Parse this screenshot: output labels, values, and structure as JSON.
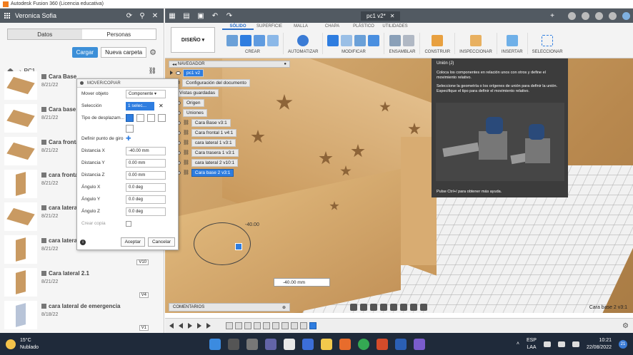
{
  "window": {
    "title": "Autodesk Fusion 360 (Licencia educativa)"
  },
  "datapanel": {
    "user": "Veronica Sofia",
    "tabs": [
      {
        "label": "Datos"
      },
      {
        "label": "Personas"
      }
    ],
    "cargar": "Cargar",
    "nueva_carpeta": "Nueva carpeta",
    "breadcrumb": "PC1",
    "files": [
      {
        "name": "Cara Base",
        "date": "8/21/22"
      },
      {
        "name": "Cara base 2",
        "date": "8/21/22"
      },
      {
        "name": "Cara frontal",
        "date": "8/21/22"
      },
      {
        "name": "cara frontal",
        "date": "8/21/22"
      },
      {
        "name": "cara lateral",
        "date": "8/21/22"
      },
      {
        "name": "cara lateral",
        "date": "8/21/22",
        "version": "V10"
      },
      {
        "name": "Cara lateral 2.1",
        "date": "8/21/22",
        "version": "V4"
      },
      {
        "name": "cara lateral de emergencia",
        "date": "8/18/22",
        "version": "V1"
      }
    ]
  },
  "toolbar": {
    "document_tab": "pc1 v2*",
    "workspace": "DISEÑO",
    "tabs": [
      "SÓLIDO",
      "SUPERFICIE",
      "MALLA",
      "CHAPA",
      "PLÁSTICO",
      "UTILIDADES"
    ],
    "groups": [
      "CREAR",
      "AUTOMATIZAR",
      "MODIFICAR",
      "ENSAMBLAR",
      "CONSTRUIR",
      "INSPECCIONAR",
      "INSERTAR",
      "SELECCIONAR"
    ]
  },
  "browser": {
    "title": "NAVEGADOR",
    "root": "pc1 v2",
    "items": [
      {
        "label": "Configuración del documento",
        "selected": false
      },
      {
        "label": "Vistas guardadas",
        "selected": false
      },
      {
        "label": "Origen",
        "selected": false
      },
      {
        "label": "Uniones",
        "selected": false
      },
      {
        "label": "Cara Base v3:1",
        "selected": false
      },
      {
        "label": "Cara frontal 1 v4:1",
        "selected": false
      },
      {
        "label": "cara lateral 1 v3:1",
        "selected": false
      },
      {
        "label": "Cara trasera 1 v3:1",
        "selected": false
      },
      {
        "label": "cara lateral 2 v10:1",
        "selected": false
      },
      {
        "label": "Cara base 2 v3:1",
        "selected": true
      }
    ]
  },
  "dialog": {
    "title": "MOVER/COPIAR",
    "rows": [
      {
        "label": "Mover objeto",
        "value": "Componente"
      },
      {
        "label": "Selección",
        "value": "1 selec..."
      },
      {
        "label": "Tipo de desplazam..."
      },
      {
        "label": "Definir punto de giro"
      },
      {
        "label": "Distancia X",
        "value": "-40.00 mm"
      },
      {
        "label": "Distancia Y",
        "value": "0.00 mm"
      },
      {
        "label": "Distancia Z",
        "value": "0.00 mm"
      },
      {
        "label": "Ángulo X",
        "value": "0.0 deg"
      },
      {
        "label": "Ángulo Y",
        "value": "0.0 deg"
      },
      {
        "label": "Ángulo Z",
        "value": "0.0 deg"
      },
      {
        "label": "Crear copia"
      }
    ],
    "ok": "Aceptar",
    "cancel": "Cancelar"
  },
  "tooltip": {
    "title": "Unión (J)",
    "p1": "Coloca los componentes en relación unos con otros y define el movimiento relativo.",
    "p2": "Seleccione la geometría o los orígenes de unión para definir la unión. Especifique el tipo para definir el movimiento relativo.",
    "footer": "Pulse Ctrl+/ para obtener más ayuda."
  },
  "viewport": {
    "distance_input": "-40.00 mm",
    "dimension_label": "-40.00",
    "comments": "COMENTARIOS",
    "selection_status": "Cara base 2 v3:1"
  },
  "taskbar": {
    "temperature": "15°C",
    "weather": "Nublado",
    "lang1": "ESP",
    "lang2": "LAA",
    "time": "10:21",
    "date": "22/08/2022",
    "notifications": "21"
  },
  "colors": {
    "accent": "#2e7de0",
    "wood": "#c99a62",
    "header": "#525a62"
  }
}
